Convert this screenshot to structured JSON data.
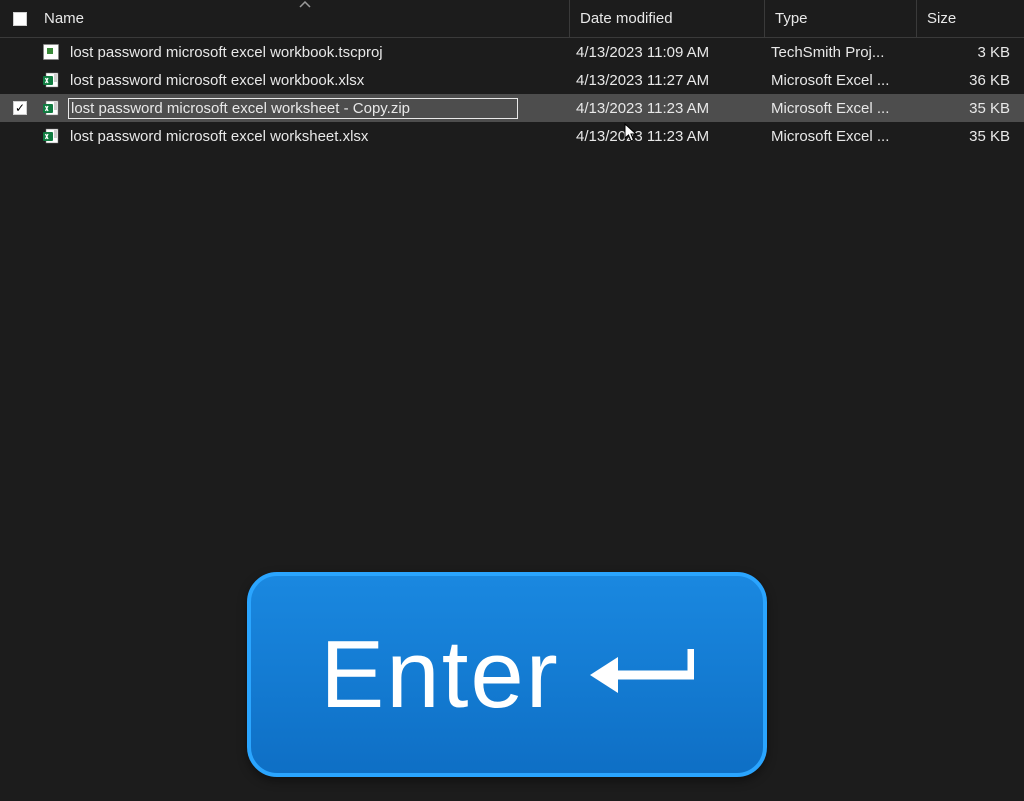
{
  "columns": {
    "name": "Name",
    "date": "Date modified",
    "type": "Type",
    "size": "Size"
  },
  "files": [
    {
      "name": "lost password microsoft excel workbook.tscproj",
      "date": "4/13/2023 11:09 AM",
      "type": "TechSmith Proj...",
      "size": "3 KB",
      "icon": "tscproj",
      "selected": false,
      "editing": false
    },
    {
      "name": "lost password microsoft excel workbook.xlsx",
      "date": "4/13/2023 11:27 AM",
      "type": "Microsoft Excel ...",
      "size": "36 KB",
      "icon": "xlsx",
      "selected": false,
      "editing": false
    },
    {
      "name": "lost password microsoft excel worksheet - Copy.zip",
      "date": "4/13/2023 11:23 AM",
      "type": "Microsoft Excel ...",
      "size": "35 KB",
      "icon": "xlsx",
      "selected": true,
      "editing": true
    },
    {
      "name": "lost password microsoft excel worksheet.xlsx",
      "date": "4/13/2023 11:23 AM",
      "type": "Microsoft Excel ...",
      "size": "35 KB",
      "icon": "xlsx",
      "selected": false,
      "editing": false
    }
  ],
  "key_overlay": {
    "label": "Enter"
  }
}
